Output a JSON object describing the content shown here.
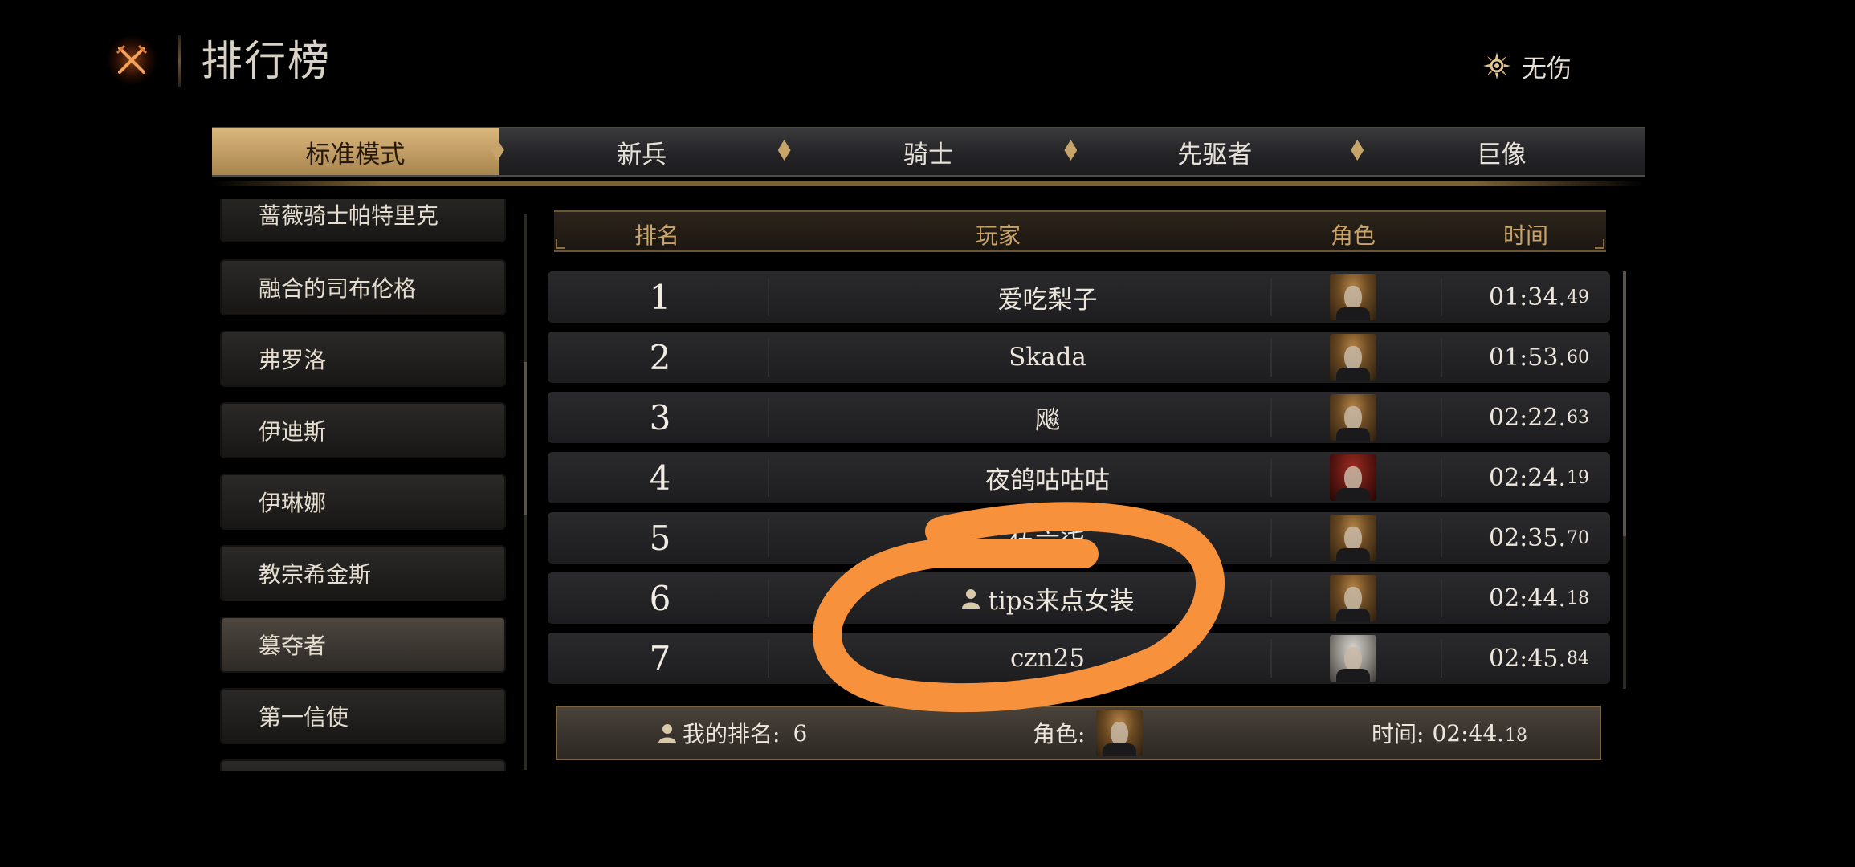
{
  "header": {
    "title": "排行榜",
    "close_icon": "crossed-swords-close-icon",
    "difficulty_icon": "sun-sigil-icon",
    "difficulty_label": "无伤"
  },
  "tabs": [
    {
      "label": "标准模式",
      "active": true
    },
    {
      "label": "新兵",
      "active": false
    },
    {
      "label": "骑士",
      "active": false
    },
    {
      "label": "先驱者",
      "active": false
    },
    {
      "label": "巨像",
      "active": false
    }
  ],
  "bosses": [
    {
      "name": "蔷薇骑士帕特里克",
      "selected": false
    },
    {
      "name": "融合的司布伦格",
      "selected": false
    },
    {
      "name": "弗罗洛",
      "selected": false
    },
    {
      "name": "伊迪斯",
      "selected": false
    },
    {
      "name": "伊琳娜",
      "selected": false
    },
    {
      "name": "教宗希金斯",
      "selected": false
    },
    {
      "name": "篡夺者",
      "selected": true
    },
    {
      "name": "第一信使",
      "selected": false
    }
  ],
  "table": {
    "columns": {
      "rank": "排名",
      "player": "玩家",
      "character": "角色",
      "time": "时间"
    },
    "rows": [
      {
        "rank": "1",
        "player": "爱吃梨子",
        "self": false,
        "portrait": "blonde",
        "time_main": "01:34.",
        "time_ms": "49"
      },
      {
        "rank": "2",
        "player": "Skada",
        "self": false,
        "portrait": "blonde",
        "time_main": "01:53.",
        "time_ms": "60"
      },
      {
        "rank": "3",
        "player": "飚",
        "self": false,
        "portrait": "blonde",
        "time_main": "02:22.",
        "time_ms": "63"
      },
      {
        "rank": "4",
        "player": "夜鸽咕咕咕",
        "self": false,
        "portrait": "red",
        "time_main": "02:24.",
        "time_ms": "19"
      },
      {
        "rank": "5",
        "player": "伍六柒",
        "self": false,
        "portrait": "blonde",
        "time_main": "02:35.",
        "time_ms": "70"
      },
      {
        "rank": "6",
        "player": "tips来点女装",
        "self": true,
        "portrait": "blonde",
        "time_main": "02:44.",
        "time_ms": "18"
      },
      {
        "rank": "7",
        "player": "czn25",
        "self": false,
        "portrait": "silver",
        "time_main": "02:45.",
        "time_ms": "84"
      }
    ]
  },
  "my_rank": {
    "rank_label": "我的排名:",
    "rank_value": "6",
    "character_label": "角色:",
    "time_label": "时间:",
    "time_main": "02:44.",
    "time_ms": "18"
  },
  "colors": {
    "accent_gold": "#c9a46a",
    "active_tab": "#c4a068",
    "annotation_orange": "#f7913c"
  }
}
